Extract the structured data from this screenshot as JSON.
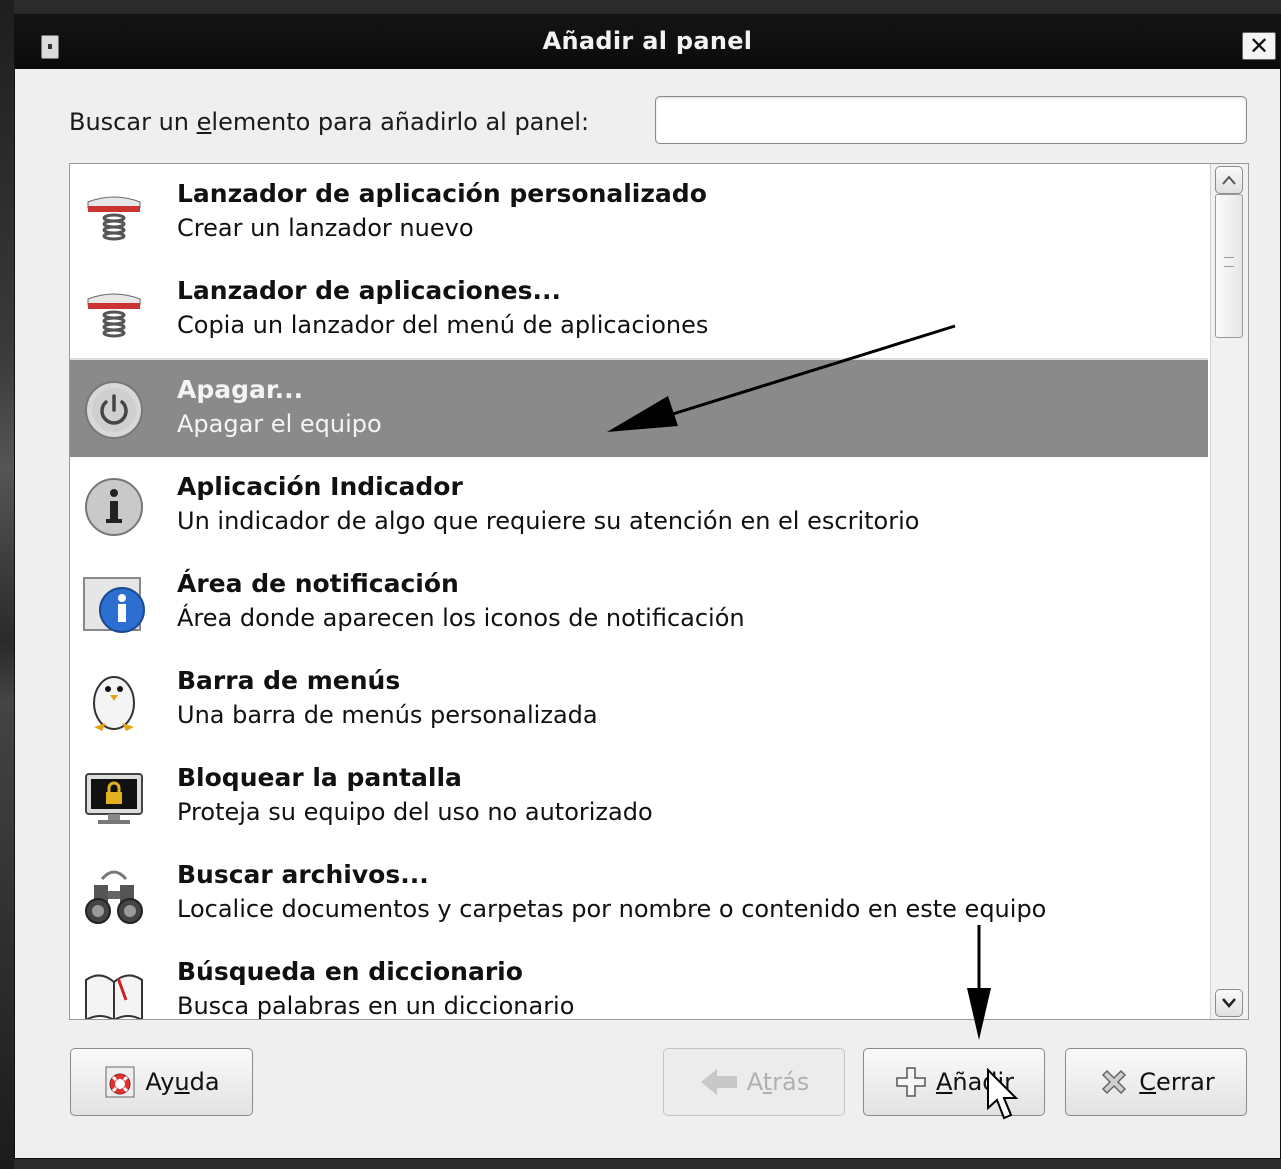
{
  "window": {
    "title": "Añadir al panel",
    "close_glyph": "✕"
  },
  "search": {
    "label_before": "Buscar un ",
    "label_mnemonic": "e",
    "label_after": "lemento para añadirlo al panel:",
    "value": "",
    "placeholder": ""
  },
  "items": [
    {
      "name": "Lanzador de aplicación personalizado",
      "desc": "Crear un lanzador nuevo",
      "icon": "launcher-spring-icon"
    },
    {
      "name": "Lanzador de aplicaciones...",
      "desc": "Copia un lanzador del menú de aplicaciones",
      "icon": "launcher-spring-icon"
    },
    {
      "name": "Apagar...",
      "desc": "Apagar el equipo",
      "icon": "power-icon",
      "selected": true
    },
    {
      "name": "Aplicación Indicador",
      "desc": "Un indicador de algo que requiere su atención en el escritorio",
      "icon": "info-grey-icon"
    },
    {
      "name": "Área de notificación",
      "desc": "Área donde aparecen los iconos de notificación",
      "icon": "info-blue-icon"
    },
    {
      "name": "Barra de menús",
      "desc": "Una barra de menús personalizada",
      "icon": "penguin-icon"
    },
    {
      "name": "Bloquear la pantalla",
      "desc": "Proteja su equipo del uso no autorizado",
      "icon": "lock-screen-icon"
    },
    {
      "name": "Buscar archivos...",
      "desc": "Localice documentos y carpetas por nombre o contenido en este equipo",
      "icon": "binoculars-icon"
    },
    {
      "name": "Búsqueda en diccionario",
      "desc": "Busca palabras en un diccionario",
      "icon": "dictionary-icon"
    }
  ],
  "buttons": {
    "help": {
      "pre": "Ay",
      "mn": "u",
      "post": "da"
    },
    "back": {
      "pre": "A",
      "mn": "t",
      "post": "rás"
    },
    "add": {
      "pre": "",
      "mn": "A",
      "post": "ñadir"
    },
    "close": {
      "pre": "",
      "mn": "C",
      "post": "errar"
    }
  },
  "colors": {
    "selection": "#8a8a8a",
    "titlebar": "#0f0f0f"
  }
}
